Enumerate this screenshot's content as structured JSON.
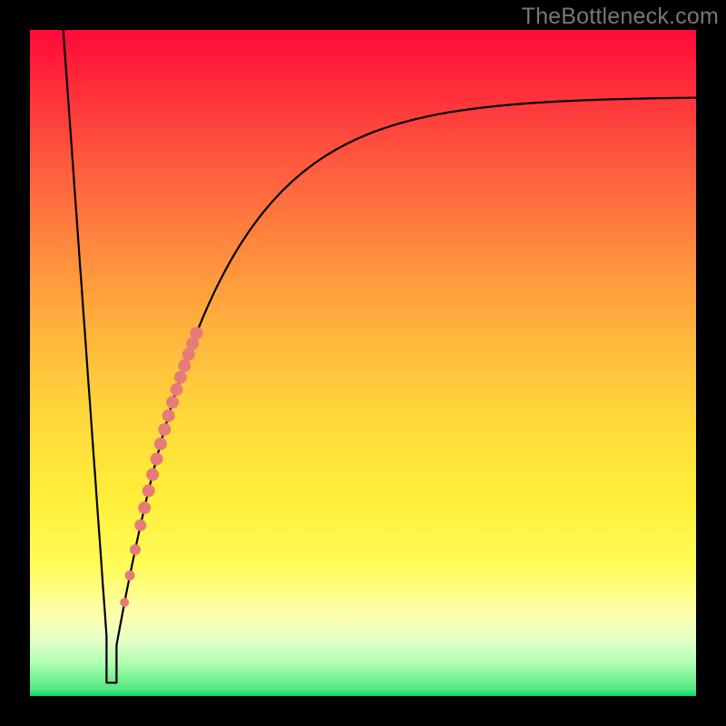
{
  "watermark": "TheBottleneck.com",
  "chart_data": {
    "type": "line",
    "title": "",
    "xlabel": "",
    "ylabel": "",
    "xlim": [
      0,
      100
    ],
    "ylim": [
      0,
      100
    ],
    "background_gradient": {
      "top_color": "#ff0a3a",
      "bottom_color": "#00d870",
      "meaning": "top=red=bad, bottom=green=good"
    },
    "series": [
      {
        "name": "bottleneck-curve",
        "comment": "black curve; y is distance from green band (0=optimal, 100=worst). Sharp V at x≈12 then asymptote toward ~90.",
        "x": [
          5,
          8,
          10,
          11,
          12,
          13,
          14,
          16,
          18,
          20,
          24,
          28,
          32,
          38,
          45,
          55,
          65,
          75,
          85,
          95,
          100
        ],
        "y": [
          100,
          55,
          18,
          5,
          2,
          2,
          5,
          15,
          28,
          38,
          52,
          62,
          69,
          75,
          80,
          84,
          86.5,
          88,
          89,
          89.7,
          90
        ]
      }
    ],
    "dots": {
      "name": "highlighted-range",
      "comment": "salmon dots along the steep right wall of the V",
      "color": "#e77b78",
      "x": [
        14.2,
        15.0,
        15.8,
        16.6,
        17.2,
        17.8,
        18.4,
        19.0,
        19.6,
        20.2,
        20.8,
        21.4,
        22.0,
        22.6,
        23.2,
        23.8,
        24.4,
        25.0
      ],
      "y": [
        7,
        11,
        15,
        19,
        22,
        25,
        28,
        31,
        34,
        36.5,
        39,
        41,
        43,
        45,
        47,
        48.5,
        50,
        51.5
      ],
      "r": [
        5,
        5.5,
        6,
        6.5,
        7,
        7,
        7,
        7,
        7,
        7,
        7,
        7,
        7,
        7,
        7,
        7,
        7,
        7
      ]
    }
  }
}
